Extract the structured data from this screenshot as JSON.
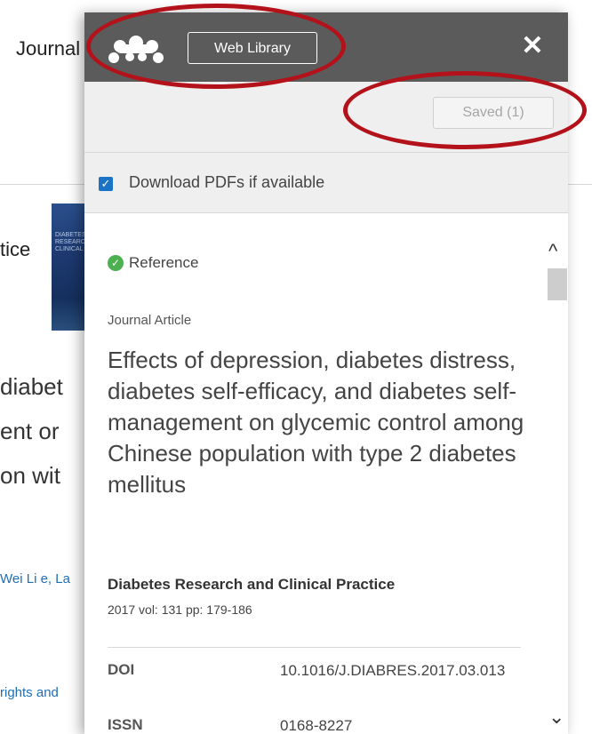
{
  "background_page": {
    "header_text": "Journal",
    "journal_suffix": "tice",
    "cover_text": "DIABETES RESEARCH CLINICAL",
    "title_fragments": [
      "diabet",
      "ent or",
      "on wit"
    ],
    "authors_fragment": "Wei Li e, La",
    "rights_fragment": "rights and"
  },
  "panel": {
    "web_library_label": "Web Library",
    "close_label": "✕",
    "saved_label": "Saved (1)",
    "download_pdfs_label": "Download PDFs if available",
    "download_pdfs_checked": true,
    "status_label": "Reference",
    "doc_type": "Journal Article",
    "title": "Effects of depression, diabetes distress, diabetes self-efficacy, and diabetes self-management on glycemic control among Chinese population with type 2 diabetes mellitus",
    "journal": "Diabetes Research and Clinical Practice",
    "journal_meta": "2017 vol: 131 pp: 179-186",
    "doi_label": "DOI",
    "doi_value": "10.1016/J.DIABRES.2017.03.013",
    "issn_label": "ISSN",
    "issn_value": "0168-8227"
  },
  "colors": {
    "header_bg": "#5b5b5b",
    "accent_checkbox": "#1a73c7",
    "status_green": "#4caf50",
    "annotation_red": "#b3121a"
  }
}
